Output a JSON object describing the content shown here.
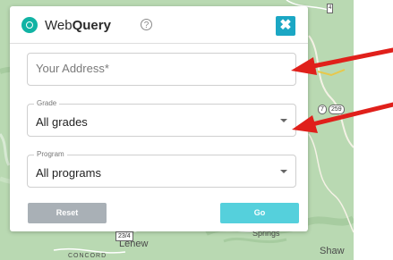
{
  "app": {
    "brand_light": "Web",
    "brand_bold": "Query",
    "help_glyph": "?",
    "close_glyph": "✖",
    "accent_color": "#1ba7c4",
    "logo_color": "#11b3a4",
    "logo_icon": "location-pin-icon",
    "help_icon": "help-circle-icon",
    "close_icon": "close-icon"
  },
  "form": {
    "address_placeholder": "Your Address*",
    "address_value": "",
    "grade": {
      "label": "Grade",
      "selected": "All grades"
    },
    "program": {
      "label": "Program",
      "selected": "All programs"
    },
    "reset_label": "Reset",
    "go_label": "Go",
    "reset_color": "#a9b0b6",
    "go_color": "#55d0dc"
  },
  "map": {
    "labels": {
      "lehew": "Lehew",
      "concord": "CONCORD",
      "shaw": "Shaw",
      "spring": "Springs"
    },
    "shields": {
      "route_234": "23/4",
      "route_259": "259",
      "route_partial": "7",
      "route_top": "4"
    }
  },
  "annotations": {
    "arrow_color": "#e0201b",
    "arrow_icon": "red-arrow-icon"
  }
}
